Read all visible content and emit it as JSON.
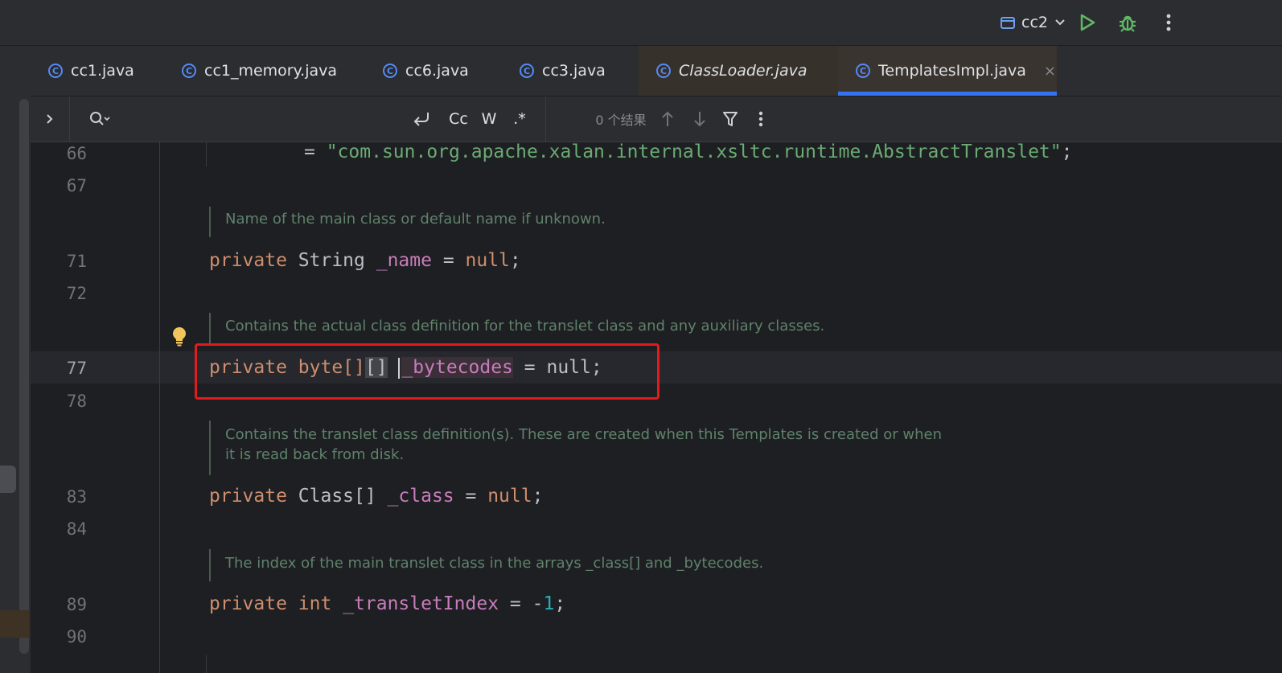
{
  "run_config": {
    "label": "cc2"
  },
  "tabs": [
    {
      "label": "cc1.java"
    },
    {
      "label": "cc1_memory.java"
    },
    {
      "label": "cc6.java"
    },
    {
      "label": "cc3.java"
    },
    {
      "label": "ClassLoader.java"
    },
    {
      "label": "TemplatesImpl.java",
      "close": "×"
    }
  ],
  "search": {
    "toggle_case": "Cc",
    "toggle_words": "W",
    "toggle_regex": ".*",
    "results": "0 个结果"
  },
  "editor": {
    "lines": {
      "l66": "66",
      "l67": "67",
      "l71": "71",
      "l72": "72",
      "l77": "77",
      "l78": "78",
      "l83": "83",
      "l84": "84",
      "l89": "89",
      "l90": "90"
    },
    "code": {
      "l66_eq": "= ",
      "l66_str": "\"com.sun.org.apache.xalan.internal.xsltc.runtime.AbstractTranslet\"",
      "l66_end": ";",
      "kw_private": "private",
      "l71_type": " String ",
      "l71_field": "_name",
      "l71_eq": " = ",
      "kw_null": "null",
      "semi": ";",
      "l77_type": " byte[]",
      "l77_brk": "[]",
      "l77_sp": " ",
      "l77_field": "_bytecodes",
      "l83_type": " Class[] ",
      "l83_field": "_class",
      "l89_type": " int",
      "l89_sp": " ",
      "l89_field": "_transletIndex",
      "l89_eq": " = -",
      "l89_num": "1"
    },
    "docs": {
      "d1": "Name of the main class or default name if unknown.",
      "d2": "Contains the actual class definition for the translet class and any auxiliary classes.",
      "d3a": "Contains the translet class definition(s). These are created when this Templates is created or when",
      "d3b": "it is read back from disk.",
      "d4": "The index of the main translet class in the arrays _class[] and _bytecodes."
    }
  },
  "colors": {
    "keyword": "#cf8e6d",
    "field": "#c77dbb",
    "string": "#6aab73",
    "number": "#2aacb8",
    "doc": "#5f826b",
    "accent": "#3574f0",
    "highlight_box": "#e31b1b"
  },
  "icons": {
    "run": "run-icon",
    "debug": "bug-icon",
    "more": "more-vertical-icon",
    "bulb": "lightbulb-icon"
  }
}
